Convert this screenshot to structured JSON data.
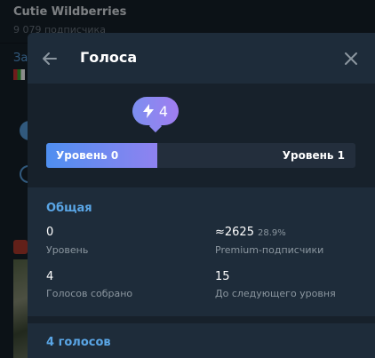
{
  "background": {
    "channel_title": "Cutie Wildberries",
    "channel_subtitle": "9 079 подписчика"
  },
  "modal": {
    "title": "Голоса",
    "boost_badge": {
      "icon": "lightning-icon",
      "count": "4"
    },
    "progress": {
      "level_from": "Уровень 0",
      "level_to": "Уровень 1",
      "fill_fraction": 0.36
    },
    "overview": {
      "heading": "Общая",
      "stats": [
        {
          "value": "0",
          "label": "Уровень"
        },
        {
          "value": "≈2625",
          "extra": "28.9%",
          "label": "Premium-подписчики"
        },
        {
          "value": "4",
          "label": "Голосов собрано"
        },
        {
          "value": "15",
          "label": "До следующего уровня"
        }
      ]
    },
    "votes_heading": "4 голосов"
  },
  "colors": {
    "accent": "#5aa6e6",
    "badge_gradient_start": "#7c8ff0",
    "badge_gradient_end": "#a07df0",
    "progress_start": "#4f8ff0",
    "progress_end": "#8f82f0"
  }
}
